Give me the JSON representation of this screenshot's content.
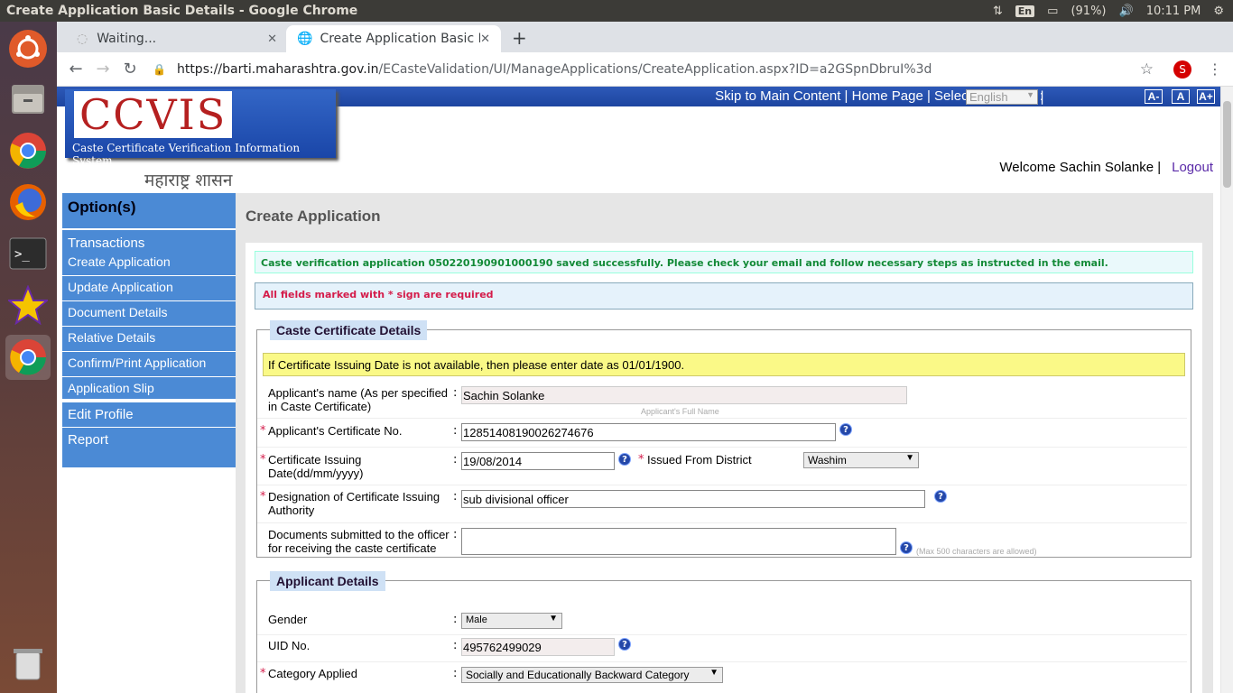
{
  "os": {
    "window_title": "Create Application Basic Details - Google Chrome",
    "input_indicator": "En",
    "battery": "(91%)",
    "time": "10:11 PM"
  },
  "browser": {
    "tabs": [
      {
        "label": "Waiting...",
        "active": false
      },
      {
        "label": "Create Application Basic D",
        "active": true
      }
    ],
    "url_host": "https://barti.maharashtra.gov.in",
    "url_path": "/ECasteValidation/UI/ManageApplications/CreateApplication.aspx?ID=a2GSpnDbruI%3d",
    "profile_initial": "S"
  },
  "header": {
    "top_links": "Skip to Main Content | Home Page | Select Language :",
    "language": "English",
    "pipe": "|",
    "font_buttons": [
      "A-",
      "A",
      "A+"
    ],
    "logo_title": "CCVIS",
    "logo_subtitle": "Caste Certificate Verification Information System",
    "state_text": "महाराष्ट्र शासन",
    "welcome": "Welcome  Sachin Solanke   |",
    "logout": "Logout"
  },
  "sidebar": {
    "heading": "Option(s)",
    "section": "Transactions",
    "items": [
      "Create Application",
      "Update Application",
      "Document Details",
      "Relative Details",
      "Confirm/Print Application",
      "Application Slip"
    ],
    "extra": [
      "Edit Profile",
      "Report"
    ]
  },
  "main": {
    "title": "Create Application",
    "success_msg": "Caste verification application 050220190901000190 saved successfully. Please check your email and follow necessary steps as instructed in the email.",
    "required_msg": "All fields marked with * sign are required",
    "caste_section": {
      "legend": "Caste Certificate Details",
      "note": "If Certificate Issuing Date is not available, then please enter date as 01/01/1900.",
      "applicant_name_label": "Applicant's name (As per specified in Caste Certificate)",
      "applicant_name_value": "Sachin Solanke",
      "applicant_name_hint": "Applicant's Full Name",
      "cert_no_label": "Applicant's Certificate No.",
      "cert_no_value": "12851408190026274676",
      "issue_date_label": "Certificate Issuing Date(dd/mm/yyyy)",
      "issue_date_value": "19/08/2014",
      "district_label": "Issued From District",
      "district_value": "Washim",
      "designation_label": "Designation of Certificate Issuing Authority",
      "designation_value": "sub divisional officer",
      "documents_label": "Documents submitted to the officer for receiving the caste certificate",
      "documents_value": "",
      "documents_hint": "(Max 500 characters are allowed)"
    },
    "applicant_section": {
      "legend": "Applicant Details",
      "gender_label": "Gender",
      "gender_value": "Male",
      "uid_label": "UID No.",
      "uid_value": "495762499029",
      "category_label": "Category Applied",
      "category_value": "Socially and Educationally Backward Category"
    }
  }
}
